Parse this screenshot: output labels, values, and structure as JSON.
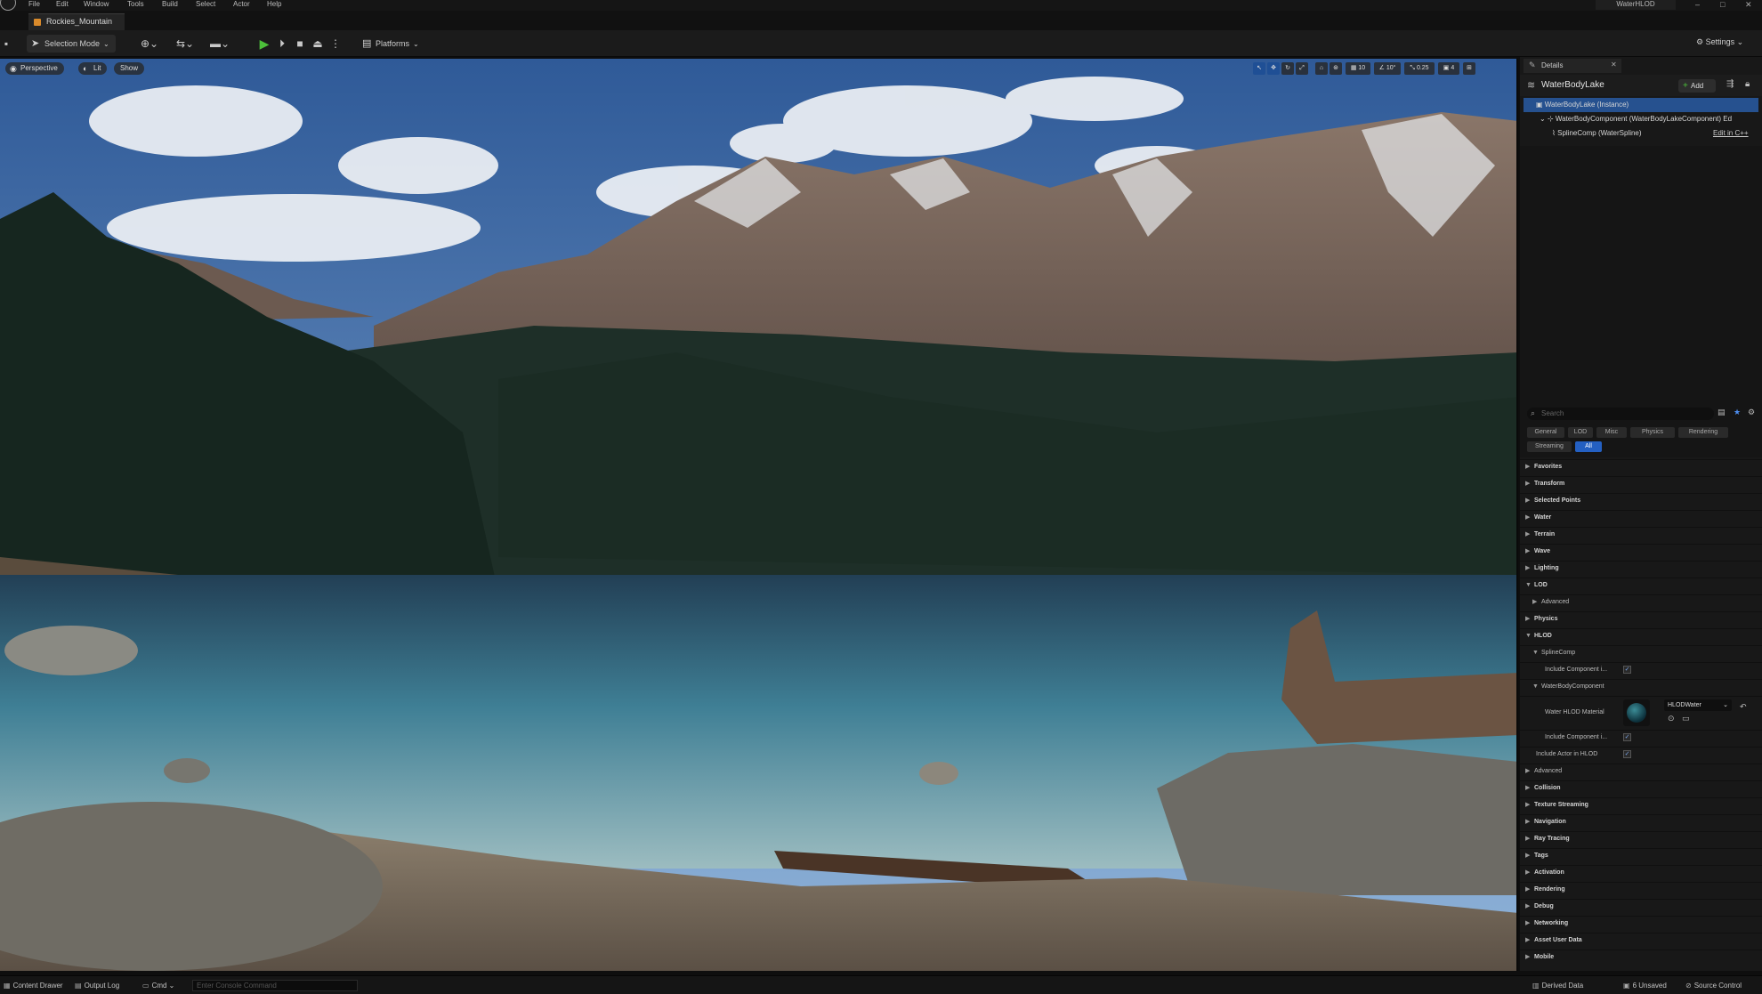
{
  "menubar": {
    "items": [
      "File",
      "Edit",
      "Window",
      "Tools",
      "Build",
      "Select",
      "Actor",
      "Help"
    ],
    "window_title": "WaterHLOD",
    "controls": [
      "–",
      "□",
      "✕"
    ]
  },
  "tabs": {
    "level": "Rockies_Mountain"
  },
  "toolbar": {
    "selection_mode": "Selection Mode",
    "platforms": "Platforms",
    "settings": "Settings"
  },
  "viewport": {
    "perspective": "Perspective",
    "lit": "Lit",
    "show": "Show",
    "tools": {
      "grid_snap": "10",
      "rotation_snap": "10°",
      "scale_snap": "0.25",
      "camera_speed": "4"
    }
  },
  "details": {
    "tab_label": "Details",
    "actor_name": "WaterBodyLake",
    "add_label": "Add",
    "components": [
      {
        "label": "WaterBodyLake (Instance)"
      },
      {
        "label": "WaterBodyComponent (WaterBodyLakeComponent)  Ed"
      },
      {
        "label": "SplineComp (WaterSpline)"
      }
    ],
    "edit_cpp": "Edit in C++",
    "search_placeholder": "Search",
    "filters_row1": [
      "General",
      "LOD",
      "Misc",
      "Physics",
      "Rendering"
    ],
    "filters_row2": [
      "Streaming",
      "All"
    ],
    "categories": {
      "favorites": "Favorites",
      "transform": "Transform",
      "selected_points": "Selected Points",
      "water": "Water",
      "terrain": "Terrain",
      "wave": "Wave",
      "lighting": "Lighting",
      "lod": "LOD",
      "advanced": "Advanced",
      "physics": "Physics",
      "hlod": "HLOD",
      "splinecomp": "SplineComp",
      "include_component_1": "Include Component i...",
      "waterbodycomponent": "WaterBodyComponent",
      "water_hlod_material": "Water HLOD Material",
      "include_component_2": "Include Component i...",
      "include_actor": "Include Actor in HLOD",
      "advanced2": "Advanced",
      "collision": "Collision",
      "texture_streaming": "Texture Streaming",
      "navigation": "Navigation",
      "ray_tracing": "Ray Tracing",
      "tags": "Tags",
      "activation": "Activation",
      "rendering": "Rendering",
      "debug": "Debug",
      "networking": "Networking",
      "asset_user_data": "Asset User Data",
      "mobile": "Mobile"
    },
    "material_value": "HLODWater"
  },
  "statusbar": {
    "content_drawer": "Content Drawer",
    "output_log": "Output Log",
    "cmd": "Cmd",
    "console_placeholder": "Enter Console Command",
    "derived_data": "Derived Data",
    "unsaved": "6 Unsaved",
    "source_control": "Source Control"
  },
  "colors": {
    "accent": "#26518f",
    "play_green": "#4cbf3a",
    "filter_active": "#2460c2"
  }
}
